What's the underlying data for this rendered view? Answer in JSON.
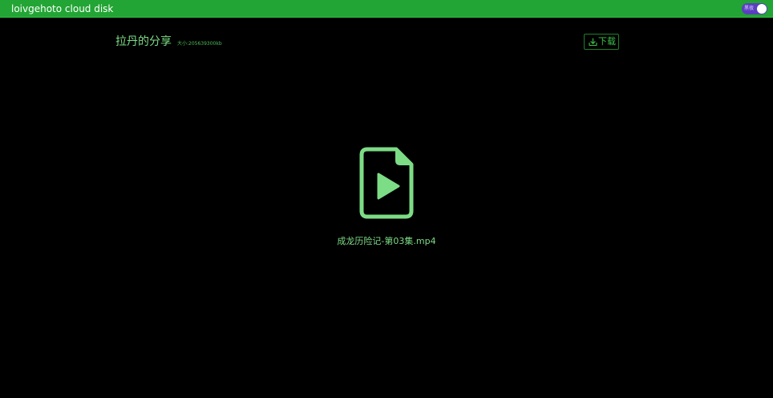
{
  "header": {
    "app_title": "loivgehoto cloud disk",
    "theme_toggle_label": "黑夜"
  },
  "share": {
    "title": "拉丹的分享",
    "size_text": "大小:205639300kb",
    "download_label": "下载"
  },
  "file": {
    "name": "成龙历险记-第03集.mp4",
    "icon": "video-file-icon"
  },
  "colors": {
    "topbar": "#22a534",
    "background": "#000000",
    "accent_text": "#7ddc86",
    "button_text": "#3fc24c",
    "toggle_track": "#5b3fbf"
  }
}
